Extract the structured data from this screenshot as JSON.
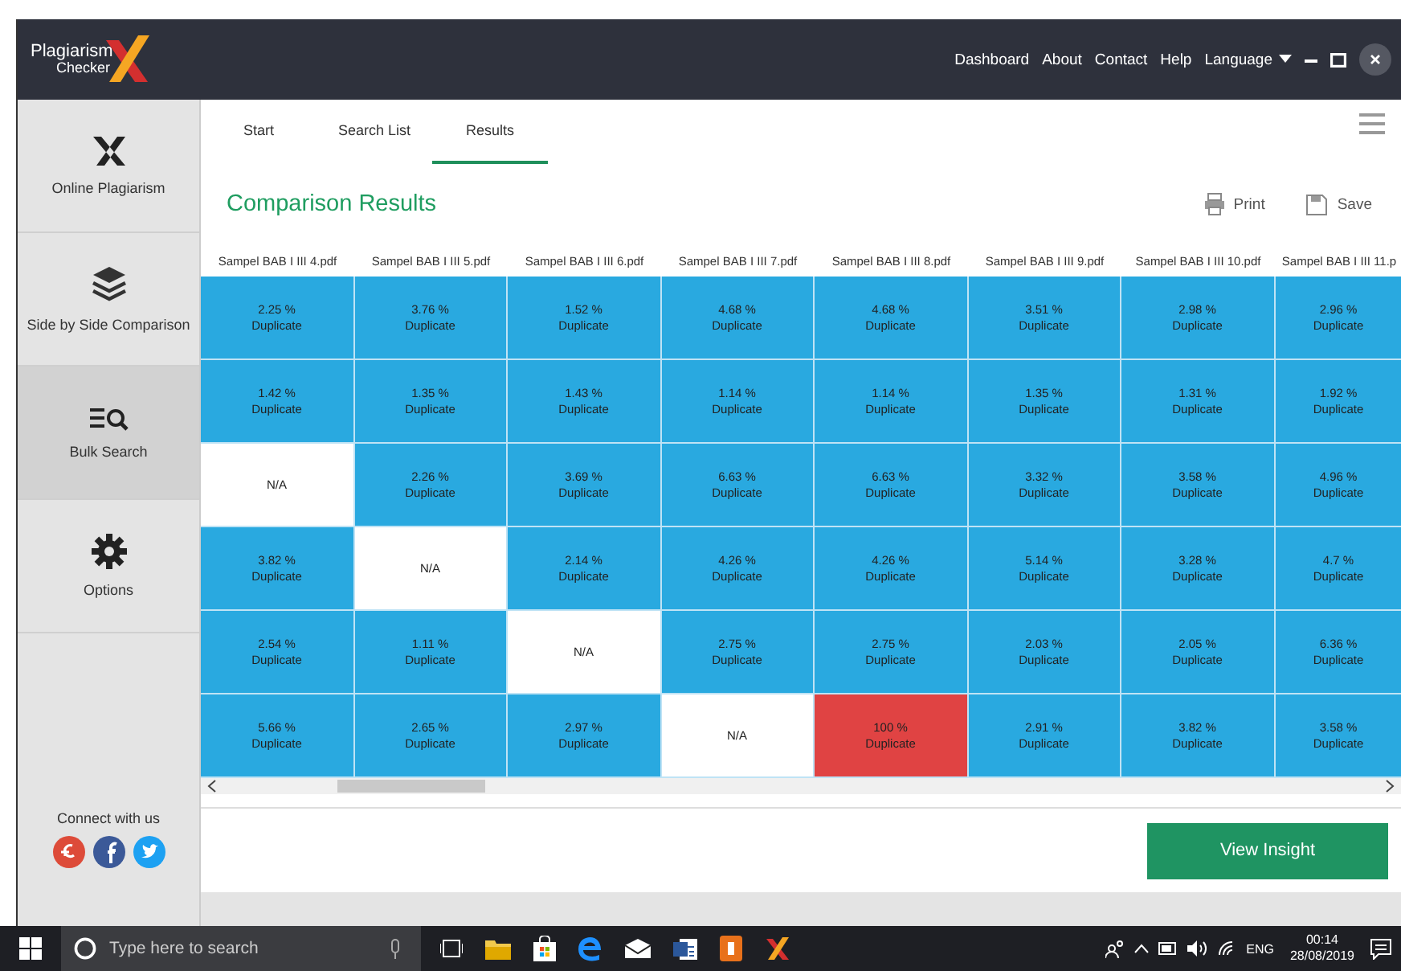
{
  "app": {
    "logo_top": "Plagiarism",
    "logo_bottom": "Checker"
  },
  "nav": [
    "Dashboard",
    "About",
    "Contact",
    "Help"
  ],
  "language": "Language",
  "sidebar": {
    "items": [
      {
        "label": "Online Plagiarism",
        "kind": "x",
        "selected": false
      },
      {
        "label": "Side by Side Comparison",
        "kind": "layers",
        "selected": false
      },
      {
        "label": "Bulk Search",
        "kind": "bulk",
        "selected": true
      },
      {
        "label": "Options",
        "kind": "gear",
        "selected": false
      }
    ],
    "connect": "Connect with us"
  },
  "tabs": [
    {
      "label": "Start",
      "selected": false
    },
    {
      "label": "Search List",
      "selected": false
    },
    {
      "label": "Results",
      "selected": true
    }
  ],
  "title": "Comparison Results",
  "actions": [
    {
      "label": "Print",
      "kind": "print"
    },
    {
      "label": "Save",
      "kind": "save"
    }
  ],
  "table": {
    "columns": [
      "Sampel BAB I III 4.pdf",
      "Sampel BAB I III 5.pdf",
      "Sampel BAB I III 6.pdf",
      "Sampel BAB I III 7.pdf",
      "Sampel BAB I III 8.pdf",
      "Sampel BAB I III 9.pdf",
      "Sampel BAB I III 10.pdf",
      "Sampel BAB I III 11.p"
    ],
    "rows": [
      [
        {
          "kind": "value",
          "percent": "2.25 %",
          "label": "Duplicate"
        },
        {
          "kind": "value",
          "percent": "3.76 %",
          "label": "Duplicate"
        },
        {
          "kind": "value",
          "percent": "1.52 %",
          "label": "Duplicate"
        },
        {
          "kind": "value",
          "percent": "4.68 %",
          "label": "Duplicate"
        },
        {
          "kind": "value",
          "percent": "4.68 %",
          "label": "Duplicate"
        },
        {
          "kind": "value",
          "percent": "3.51 %",
          "label": "Duplicate"
        },
        {
          "kind": "value",
          "percent": "2.98 %",
          "label": "Duplicate"
        },
        {
          "kind": "value",
          "percent": "2.96 %",
          "label": "Duplicate"
        }
      ],
      [
        {
          "kind": "value",
          "percent": "1.42 %",
          "label": "Duplicate"
        },
        {
          "kind": "value",
          "percent": "1.35 %",
          "label": "Duplicate"
        },
        {
          "kind": "value",
          "percent": "1.43 %",
          "label": "Duplicate"
        },
        {
          "kind": "value",
          "percent": "1.14 %",
          "label": "Duplicate"
        },
        {
          "kind": "value",
          "percent": "1.14 %",
          "label": "Duplicate"
        },
        {
          "kind": "value",
          "percent": "1.35 %",
          "label": "Duplicate"
        },
        {
          "kind": "value",
          "percent": "1.31 %",
          "label": "Duplicate"
        },
        {
          "kind": "value",
          "percent": "1.92 %",
          "label": "Duplicate"
        }
      ],
      [
        {
          "kind": "na",
          "label": "N/A"
        },
        {
          "kind": "value",
          "percent": "2.26 %",
          "label": "Duplicate"
        },
        {
          "kind": "value",
          "percent": "3.69 %",
          "label": "Duplicate"
        },
        {
          "kind": "value",
          "percent": "6.63 %",
          "label": "Duplicate"
        },
        {
          "kind": "value",
          "percent": "6.63 %",
          "label": "Duplicate"
        },
        {
          "kind": "value",
          "percent": "3.32 %",
          "label": "Duplicate"
        },
        {
          "kind": "value",
          "percent": "3.58 %",
          "label": "Duplicate"
        },
        {
          "kind": "value",
          "percent": "4.96 %",
          "label": "Duplicate"
        }
      ],
      [
        {
          "kind": "value",
          "percent": "3.82 %",
          "label": "Duplicate"
        },
        {
          "kind": "na",
          "label": "N/A"
        },
        {
          "kind": "value",
          "percent": "2.14 %",
          "label": "Duplicate"
        },
        {
          "kind": "value",
          "percent": "4.26 %",
          "label": "Duplicate"
        },
        {
          "kind": "value",
          "percent": "4.26 %",
          "label": "Duplicate"
        },
        {
          "kind": "value",
          "percent": "5.14 %",
          "label": "Duplicate"
        },
        {
          "kind": "value",
          "percent": "3.28 %",
          "label": "Duplicate"
        },
        {
          "kind": "value",
          "percent": "4.7 %",
          "label": "Duplicate"
        }
      ],
      [
        {
          "kind": "value",
          "percent": "2.54 %",
          "label": "Duplicate"
        },
        {
          "kind": "value",
          "percent": "1.11 %",
          "label": "Duplicate"
        },
        {
          "kind": "na",
          "label": "N/A"
        },
        {
          "kind": "value",
          "percent": "2.75 %",
          "label": "Duplicate"
        },
        {
          "kind": "value",
          "percent": "2.75 %",
          "label": "Duplicate"
        },
        {
          "kind": "value",
          "percent": "2.03 %",
          "label": "Duplicate"
        },
        {
          "kind": "value",
          "percent": "2.05 %",
          "label": "Duplicate"
        },
        {
          "kind": "value",
          "percent": "6.36 %",
          "label": "Duplicate"
        }
      ],
      [
        {
          "kind": "value",
          "percent": "5.66 %",
          "label": "Duplicate"
        },
        {
          "kind": "value",
          "percent": "2.65 %",
          "label": "Duplicate"
        },
        {
          "kind": "value",
          "percent": "2.97 %",
          "label": "Duplicate"
        },
        {
          "kind": "na",
          "label": "N/A"
        },
        {
          "kind": "high",
          "percent": "100 %",
          "label": "Duplicate"
        },
        {
          "kind": "value",
          "percent": "2.91 %",
          "label": "Duplicate"
        },
        {
          "kind": "value",
          "percent": "3.82 %",
          "label": "Duplicate"
        },
        {
          "kind": "value",
          "percent": "3.58 %",
          "label": "Duplicate"
        }
      ]
    ]
  },
  "insight_button": "View Insight",
  "taskbar": {
    "search_placeholder": "Type here to search",
    "lang": "ENG",
    "time": "00:14",
    "date": "28/08/2019"
  }
}
